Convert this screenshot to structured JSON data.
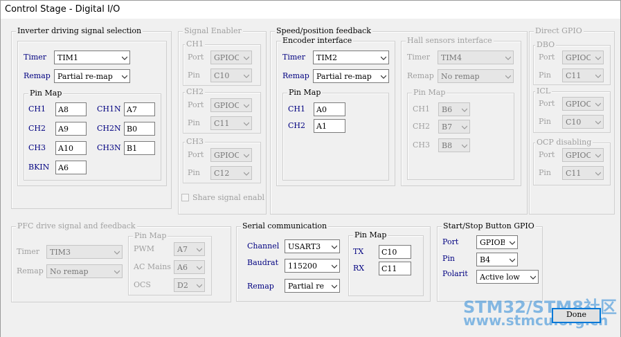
{
  "window": {
    "title": "Control Stage - Digital I/O"
  },
  "inverter": {
    "title": "Inverter driving signal selection",
    "timer_label": "Timer",
    "timer_value": "TIM1",
    "remap_label": "Remap",
    "remap_value": "Partial re-map",
    "pinmap_title": "Pin Map",
    "pins": [
      {
        "label": "CH1",
        "value": "A8"
      },
      {
        "label": "CH1N",
        "value": "A7"
      },
      {
        "label": "CH2",
        "value": "A9"
      },
      {
        "label": "CH2N",
        "value": "B0"
      },
      {
        "label": "CH3",
        "value": "A10"
      },
      {
        "label": "CH3N",
        "value": "B1"
      },
      {
        "label": "BKIN",
        "value": "A6"
      }
    ]
  },
  "signal_enabler": {
    "title": "Signal Enabler",
    "groups": [
      {
        "title": "CH1",
        "port_label": "Port",
        "port_value": "GPIOC",
        "pin_label": "Pin",
        "pin_value": "C10"
      },
      {
        "title": "CH2",
        "port_label": "Port",
        "port_value": "GPIOC",
        "pin_label": "Pin",
        "pin_value": "C11"
      },
      {
        "title": "CH3",
        "port_label": "Port",
        "port_value": "GPIOC",
        "pin_label": "Pin",
        "pin_value": "C12"
      }
    ],
    "share_label": "Share signal enabl"
  },
  "speed_feedback": {
    "title": "Speed/position feedback",
    "encoder": {
      "title": "Encoder interface",
      "timer_label": "Timer",
      "timer_value": "TIM2",
      "remap_label": "Remap",
      "remap_value": "Partial re-map",
      "pinmap_title": "Pin Map",
      "pins": [
        {
          "label": "CH1",
          "value": "A0"
        },
        {
          "label": "CH2",
          "value": "A1"
        }
      ]
    },
    "hall": {
      "title": "Hall sensors interface",
      "timer_label": "Timer",
      "timer_value": "TIM4",
      "remap_label": "Remap",
      "remap_value": "No remap",
      "pinmap_title": "Pin Map",
      "pins": [
        {
          "label": "CH1",
          "value": "B6"
        },
        {
          "label": "CH2",
          "value": "B7"
        },
        {
          "label": "CH3",
          "value": "B8"
        }
      ]
    }
  },
  "direct_gpio": {
    "title": "Direct GPIO",
    "groups": [
      {
        "title": "DBO",
        "port_label": "Port",
        "port_value": "GPIOC",
        "pin_label": "Pin",
        "pin_value": "C11"
      },
      {
        "title": "ICL",
        "port_label": "Port",
        "port_value": "GPIOC",
        "pin_label": "Pin",
        "pin_value": "C10"
      },
      {
        "title": "OCP disabling",
        "port_label": "Port",
        "port_value": "GPIOC",
        "pin_label": "Pin",
        "pin_value": "C11"
      }
    ]
  },
  "pfc": {
    "title": "PFC drive signal and feedback",
    "timer_label": "Timer",
    "timer_value": "TIM3",
    "remap_label": "Remap",
    "remap_value": "No remap",
    "pinmap_title": "Pin Map",
    "pins": [
      {
        "label": "PWM",
        "value": "A7"
      },
      {
        "label": "AC Mains",
        "value": "A6"
      },
      {
        "label": "OCS",
        "value": "D2"
      }
    ]
  },
  "serial": {
    "title": "Serial communication",
    "channel_label": "Channel",
    "channel_value": "USART3",
    "baudrate_label": "Baudrat",
    "baudrate_value": "115200",
    "remap_label": "Remap",
    "remap_value": "Partial re",
    "pinmap_title": "Pin Map",
    "pins": [
      {
        "label": "TX",
        "value": "C10"
      },
      {
        "label": "RX",
        "value": "C11"
      }
    ]
  },
  "startstop": {
    "title": "Start/Stop Button GPIO",
    "port_label": "Port",
    "port_value": "GPIOB",
    "pin_label": "Pin",
    "pin_value": "B4",
    "polarity_label": "Polarit",
    "polarity_value": "Active low"
  },
  "done_label": "Done",
  "watermark": {
    "line1": "STM32/STM8社区",
    "line2": "www.stmcu.org.cn"
  }
}
